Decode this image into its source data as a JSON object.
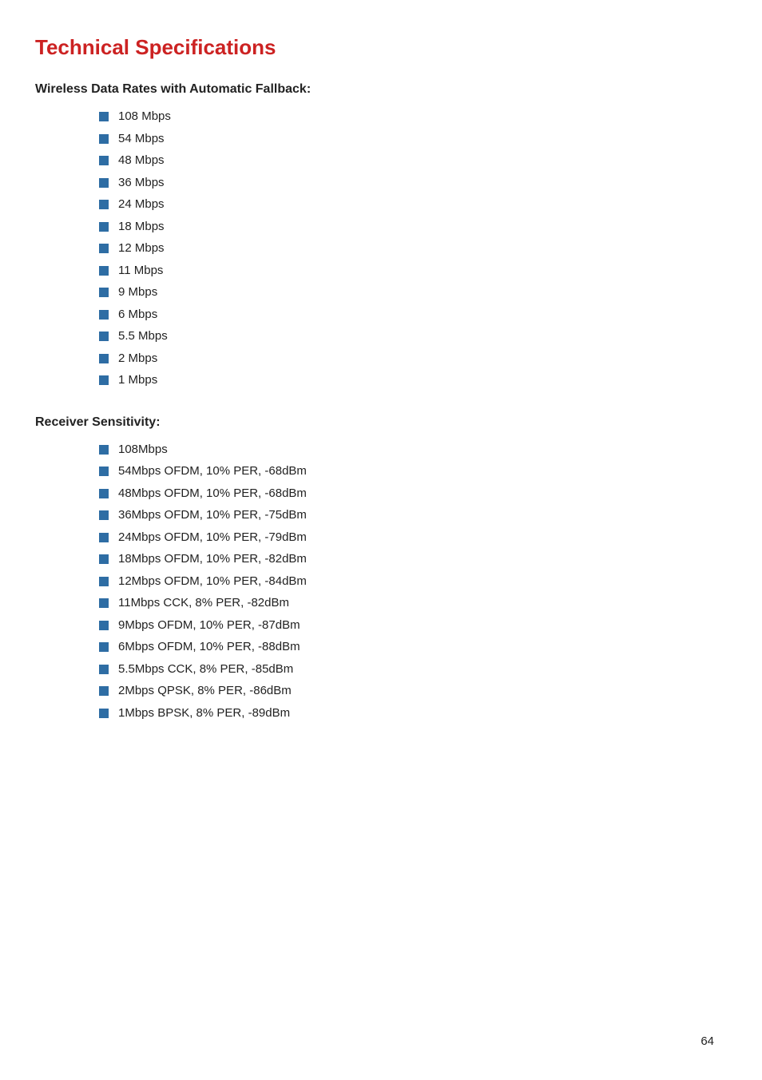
{
  "page": {
    "title": "Technical Specifications",
    "page_number": "64"
  },
  "sections": [
    {
      "id": "wireless-data-rates",
      "heading": "Wireless Data Rates with Automatic Fallback:",
      "items": [
        "108 Mbps",
        "54 Mbps",
        "48 Mbps",
        "36 Mbps",
        "24 Mbps",
        "18 Mbps",
        "12 Mbps",
        "11 Mbps",
        "9 Mbps",
        "6 Mbps",
        "5.5 Mbps",
        "2 Mbps",
        "1 Mbps"
      ]
    },
    {
      "id": "receiver-sensitivity",
      "heading": "Receiver  Sensitivity:",
      "items": [
        "108Mbps",
        "54Mbps OFDM, 10% PER, -68dBm",
        "48Mbps OFDM, 10% PER, -68dBm",
        "36Mbps OFDM, 10% PER, -75dBm",
        "24Mbps OFDM, 10% PER, -79dBm",
        "18Mbps OFDM, 10% PER, -82dBm",
        "12Mbps OFDM, 10% PER, -84dBm",
        "11Mbps CCK, 8% PER, -82dBm",
        "9Mbps OFDM, 10% PER, -87dBm",
        "6Mbps OFDM, 10% PER, -88dBm",
        "5.5Mbps CCK, 8% PER, -85dBm",
        "2Mbps  QPSK, 8% PER, -86dBm",
        "1Mbps BPSK, 8% PER, -89dBm"
      ]
    }
  ],
  "colors": {
    "title_red": "#cc2222",
    "bullet_blue": "#2e6da4"
  }
}
